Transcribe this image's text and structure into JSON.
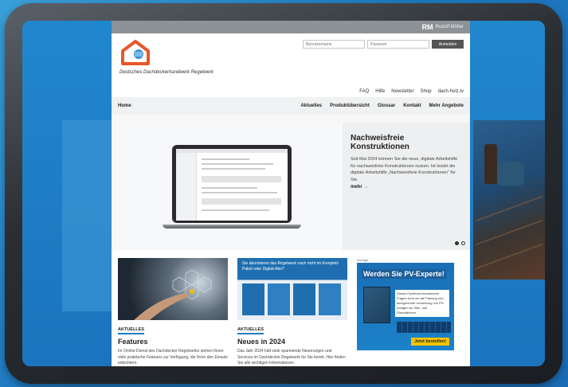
{
  "topbar": {
    "initials": "RM",
    "user": "Rudolf Müller"
  },
  "header": {
    "tagline": "Deutsches Dachdeckerhandwerk Regelwerk",
    "login": {
      "username_placeholder": "Benutzername",
      "password_placeholder": "Passwort",
      "submit_label": "Anmelden"
    },
    "util_nav": [
      "FAQ",
      "Hilfe",
      "Newsletter",
      "Shop",
      "dach-holz.tv"
    ]
  },
  "main_nav": {
    "home": "Home",
    "items": [
      "Aktuelles",
      "Produktübersicht",
      "Glossar",
      "Kontakt",
      "Mehr Angebote"
    ]
  },
  "hero": {
    "title": "Nachweisfreie Konstruktionen",
    "text": "Seit Mai 2024 können Sie die neue, digitale Arbeitshilfe für nachweisfreie Konstruktionen nutzen. Ist leistet die digitale Arbeitshilfe „Nachweisfreie Konstruktionen“ für Sie.",
    "more_label": "mehr",
    "more_arrow": "→"
  },
  "cards": [
    {
      "tag": "AKTUELLES",
      "title": "Features",
      "text": "Im Online-Dienst des Dachdecker Regelwerks stehen Ihnen viele praktische Features zur Verfügung, die Ihren den Einsatz erleichtern."
    },
    {
      "tag": "AKTUELLES",
      "title": "Neues in 2024",
      "text": "Das Jahr 2024 hält viele spannende Neuerungen und Services im Dachdecker Regelwerk für Sie bereit. Hier finden Sie alle wichtigen Informationen.",
      "image_caption": "Sie abonnieren das Regelwerk nach nicht im Komplett-Paket oder Digital-Abo?"
    }
  ],
  "ad": {
    "label": "Anzeige",
    "title": "Werden Sie PV-Experte!",
    "text": "Dieses Fachbuch beantwortet Fragen rund um die Planung und fachgerechte Umsetzung von PV-Anlagen an Steil- und Flachdächern.",
    "button": "Jetzt bestellen!"
  },
  "colors": {
    "accent": "#1a7cc8",
    "logo": "#e8562a",
    "cta": "#f5c400"
  }
}
